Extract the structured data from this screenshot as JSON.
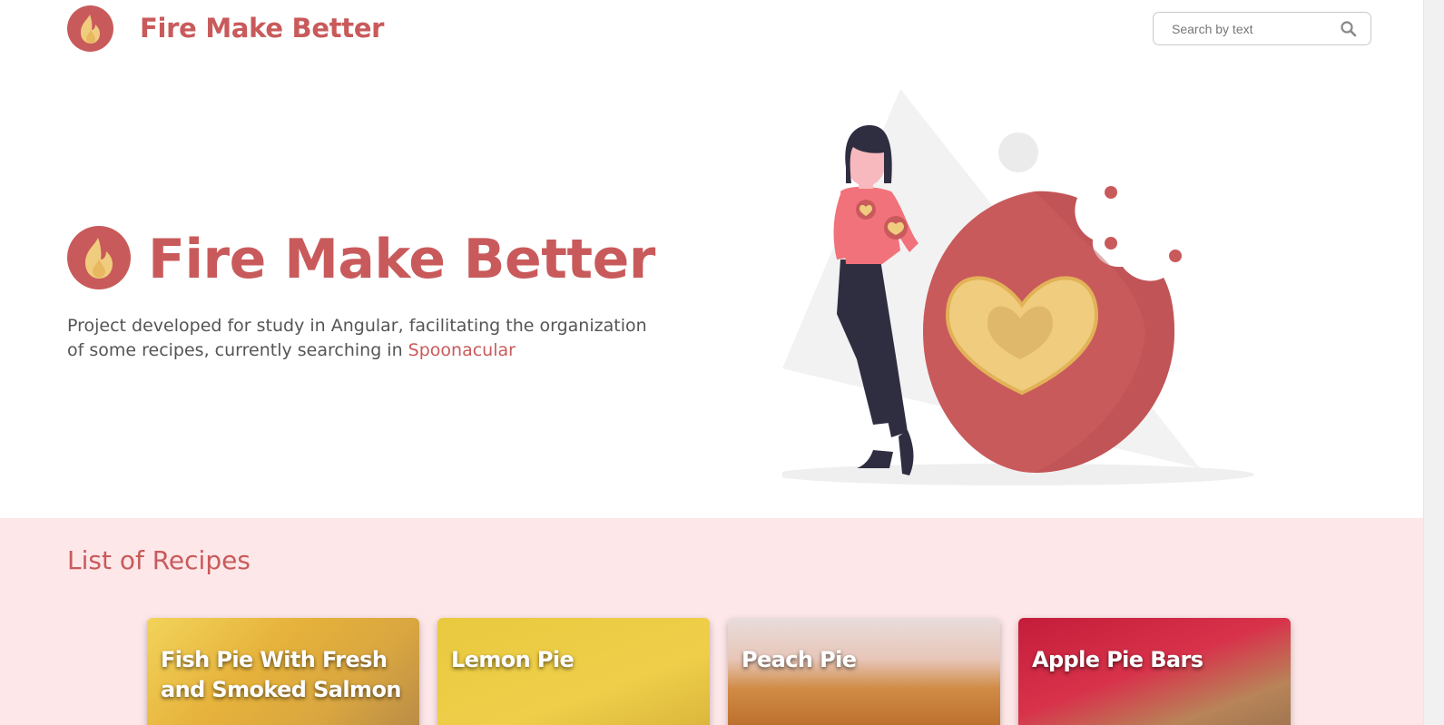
{
  "header": {
    "brand": "Fire Make Better",
    "search_placeholder": "Search by text"
  },
  "hero": {
    "title": "Fire Make Better",
    "description_prefix": "Project developed for study in Angular, facilitating the organization of some recipes, currently searching in ",
    "description_link": "Spoonacular"
  },
  "recipes": {
    "heading": "List of Recipes",
    "items": [
      {
        "title": "Fish Pie With Fresh and Smoked Salmon"
      },
      {
        "title": "Lemon Pie"
      },
      {
        "title": "Peach Pie"
      },
      {
        "title": "Apple Pie Bars"
      }
    ]
  },
  "colors": {
    "brand": "#c95a5b",
    "section_bg": "#fde7e8",
    "heart_fill": "#f0cc7e"
  },
  "icons": {
    "logo": "flame-icon",
    "search": "search-icon"
  }
}
